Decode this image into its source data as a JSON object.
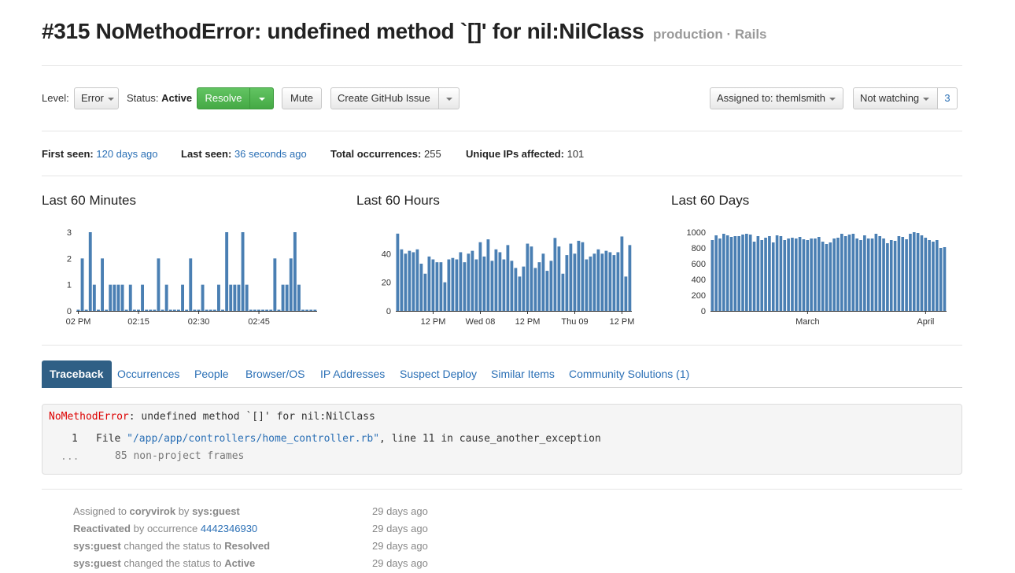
{
  "header": {
    "title": "#315 NoMethodError: undefined method `[]' for nil:NilClass",
    "environment": "production · Rails"
  },
  "toolbar": {
    "level_label": "Level:",
    "level_value": "Error",
    "status_label": "Status:",
    "status_value": "Active",
    "resolve_label": "Resolve",
    "mute_label": "Mute",
    "github_label": "Create GitHub Issue",
    "assigned_label": "Assigned to: themlsmith",
    "watching_label": "Not watching",
    "watchers_count": "3"
  },
  "stats": {
    "first_seen_label": "First seen:",
    "first_seen_value": "120 days ago",
    "last_seen_label": "Last seen:",
    "last_seen_value": "36 seconds ago",
    "total_label": "Total occurrences:",
    "total_value": "255",
    "unique_label": "Unique IPs affected:",
    "unique_value": "101"
  },
  "colors": {
    "bar": "#4a7fb3",
    "accent": "#2a6fb5",
    "tab_active": "#2f5f85",
    "green": "#4cae4c"
  },
  "chart_data": [
    {
      "type": "bar",
      "title": "Last 60 Minutes",
      "ylim": [
        0,
        3
      ],
      "yticks": [
        "0",
        "1",
        "2",
        "3"
      ],
      "xticks": [
        {
          "label": "02 PM",
          "index": 0
        },
        {
          "label": "02:15",
          "index": 15
        },
        {
          "label": "02:30",
          "index": 30
        },
        {
          "label": "02:45",
          "index": 45
        }
      ],
      "values": [
        0,
        2,
        0,
        3,
        1,
        0,
        2,
        0,
        1,
        1,
        1,
        1,
        0,
        1,
        0,
        0,
        1,
        0,
        0,
        0,
        2,
        0,
        1,
        0,
        0,
        0,
        1,
        0,
        2,
        0,
        0,
        1,
        0,
        0,
        0,
        1,
        0,
        3,
        1,
        1,
        1,
        3,
        1,
        0,
        0,
        0,
        0,
        0,
        0,
        2,
        0,
        1,
        1,
        2,
        3,
        1,
        0,
        0,
        0,
        0
      ],
      "small_values": [
        0.1,
        0.1,
        0.1,
        0.1,
        0.1,
        0.1,
        0.1,
        0.1,
        0.1,
        0.1,
        0.1,
        0.1,
        0.1,
        0.1,
        0.1,
        0.1,
        0.1,
        0.1,
        0.1,
        0.1,
        0.1,
        0.1,
        0.1,
        0.1,
        0.1,
        0.1,
        0.1,
        0.1,
        0.1,
        0.1,
        0.1,
        0.1,
        0.1,
        0.1,
        0.1,
        0.1,
        0.1,
        0.1,
        0.1,
        0.1,
        0.1,
        0.1,
        0.1,
        0.1,
        0.1,
        0.1,
        0.1,
        0.1,
        0.1,
        0.1,
        0.1,
        0.1,
        0.1,
        0.1,
        0.1,
        0.1,
        0.1,
        0.1,
        0.1,
        0.1
      ]
    },
    {
      "type": "bar",
      "title": "Last 60 Hours",
      "ylim": [
        0,
        55
      ],
      "yticks": [
        "0",
        "20",
        "40"
      ],
      "ytick_values": [
        0,
        20,
        40
      ],
      "xticks": [
        {
          "label": "12 PM",
          "index": 9
        },
        {
          "label": "Wed 08",
          "index": 21
        },
        {
          "label": "12 PM",
          "index": 33
        },
        {
          "label": "Thu 09",
          "index": 45
        },
        {
          "label": "12 PM",
          "index": 57
        }
      ],
      "values": [
        54,
        43,
        40,
        42,
        41,
        43,
        33,
        26,
        38,
        36,
        34,
        34,
        20,
        36,
        37,
        36,
        41,
        34,
        40,
        42,
        36,
        48,
        38,
        50,
        35,
        43,
        41,
        36,
        46,
        35,
        30,
        24,
        31,
        47,
        45,
        30,
        34,
        40,
        28,
        35,
        51,
        45,
        26,
        39,
        47,
        40,
        49,
        48,
        36,
        38,
        40,
        43,
        40,
        42,
        41,
        39,
        41,
        52,
        24,
        46
      ]
    },
    {
      "type": "bar",
      "title": "Last 60 Days",
      "ylim": [
        0,
        1000
      ],
      "yticks": [
        "0",
        "200",
        "400",
        "600",
        "800",
        "1000"
      ],
      "ytick_values": [
        0,
        200,
        400,
        600,
        800,
        1000
      ],
      "xticks": [
        {
          "label": "March",
          "index": 25
        },
        {
          "label": "April",
          "index": 56
        }
      ],
      "values": [
        900,
        960,
        920,
        980,
        960,
        940,
        950,
        950,
        970,
        980,
        970,
        880,
        950,
        900,
        930,
        950,
        870,
        960,
        950,
        900,
        920,
        930,
        920,
        940,
        910,
        900,
        920,
        920,
        940,
        880,
        850,
        870,
        920,
        930,
        980,
        950,
        970,
        980,
        920,
        900,
        960,
        920,
        920,
        980,
        950,
        920,
        860,
        900,
        890,
        950,
        940,
        910,
        980,
        1000,
        990,
        960,
        930,
        900,
        880,
        900,
        800,
        810
      ]
    }
  ],
  "tabs": [
    {
      "label": "Traceback"
    },
    {
      "label": "Occurrences"
    },
    {
      "label": "People"
    },
    {
      "label": "Browser/OS"
    },
    {
      "label": "IP Addresses"
    },
    {
      "label": "Suspect Deploy"
    },
    {
      "label": "Similar Items"
    },
    {
      "label": "Community Solutions (1)"
    }
  ],
  "traceback": {
    "error_class": "NoMethodError",
    "error_message": ": undefined method `[]' for nil:NilClass",
    "frame_number": "1",
    "frame_prefix": "File ",
    "frame_file": "\"/app/app/controllers/home_controller.rb\"",
    "frame_suffix": ", line 11 in cause_another_exception",
    "ellipsis": "...",
    "non_project": "85 non-project frames"
  },
  "activity": [
    {
      "pre": "Assigned to ",
      "b1": "coryvirok",
      "mid": " by ",
      "b2": "sys:guest",
      "link": "",
      "time": "29 days ago"
    },
    {
      "pre": "",
      "b1": "Reactivated",
      "mid": " by occurrence ",
      "b2": "",
      "link": "4442346930",
      "time": "29 days ago"
    },
    {
      "pre": "",
      "b1": "sys:guest",
      "mid": " changed the status to ",
      "b2": "Resolved",
      "link": "",
      "time": "29 days ago"
    },
    {
      "pre": "",
      "b1": "sys:guest",
      "mid": " changed the status to ",
      "b2": "Active",
      "link": "",
      "time": "29 days ago"
    }
  ]
}
